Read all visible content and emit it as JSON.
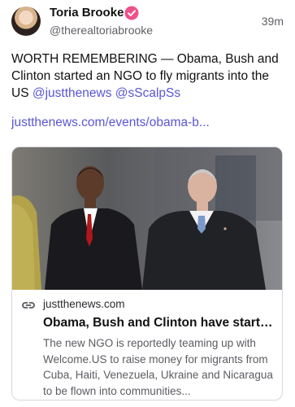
{
  "author": {
    "display_name": "Toria Brooke",
    "handle": "@therealtoriabrooke",
    "verified_badge_color": "#f0508a",
    "time": "39m"
  },
  "post": {
    "text": "WORTH REMEMBERING — Obama, Bush and Clinton started an NGO to fly migrants into the US",
    "mentions": [
      "@justthenews",
      "@sScalpSs"
    ],
    "link": "justthenews.com/events/obama-b..."
  },
  "link_card": {
    "domain": "justthenews.com",
    "title": "Obama, Bush and Clinton have starte...",
    "description": "The new NGO is reportedly teaming up with Welcome.US to raise money for migrants from Cuba, Haiti, Venezuela, Ukraine and Nicaragua to be flown into communities..."
  },
  "colors": {
    "accent": "#5a55d6",
    "text": "#111111",
    "secondary_text": "#606066"
  }
}
